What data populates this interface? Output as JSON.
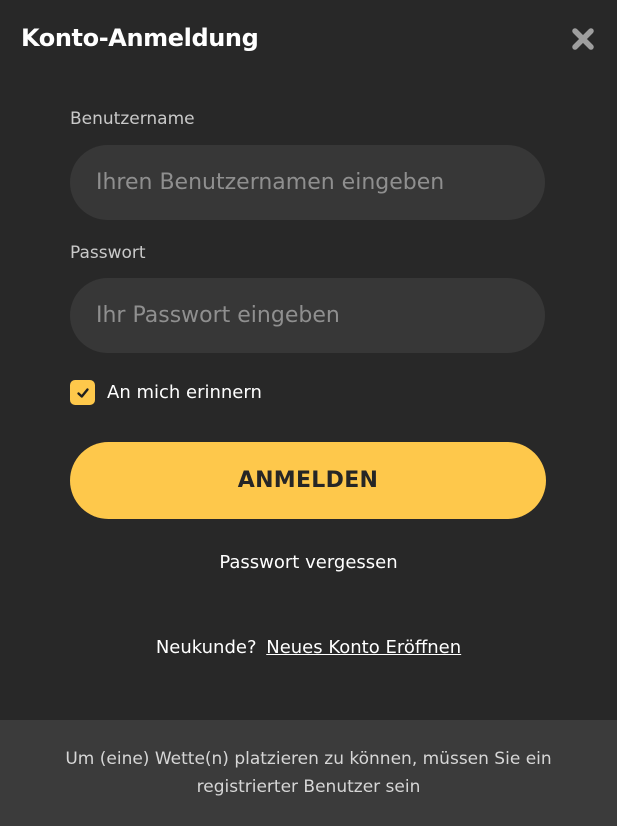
{
  "modal": {
    "title": "Konto-Anmeldung",
    "close_icon": "close-icon"
  },
  "form": {
    "username_label": "Benutzername",
    "username_placeholder": "Ihren Benutzernamen eingeben",
    "username_value": "",
    "password_label": "Passwort",
    "password_placeholder": "Ihr Passwort eingeben",
    "password_value": "",
    "remember_label": "An mich erinnern",
    "remember_checked": true,
    "submit_label": "ANMELDEN",
    "forgot_label": "Passwort vergessen"
  },
  "register": {
    "prompt": "Neukunde?",
    "link_label": "Neues Konto Eröffnen"
  },
  "footer": {
    "notice": "Um (eine) Wette(n) platzieren zu können, müssen Sie ein registrierter Benutzer sein"
  },
  "colors": {
    "background": "#282828",
    "input_background": "#373737",
    "accent": "#fec84b",
    "footer_background": "#3b3b3b"
  }
}
